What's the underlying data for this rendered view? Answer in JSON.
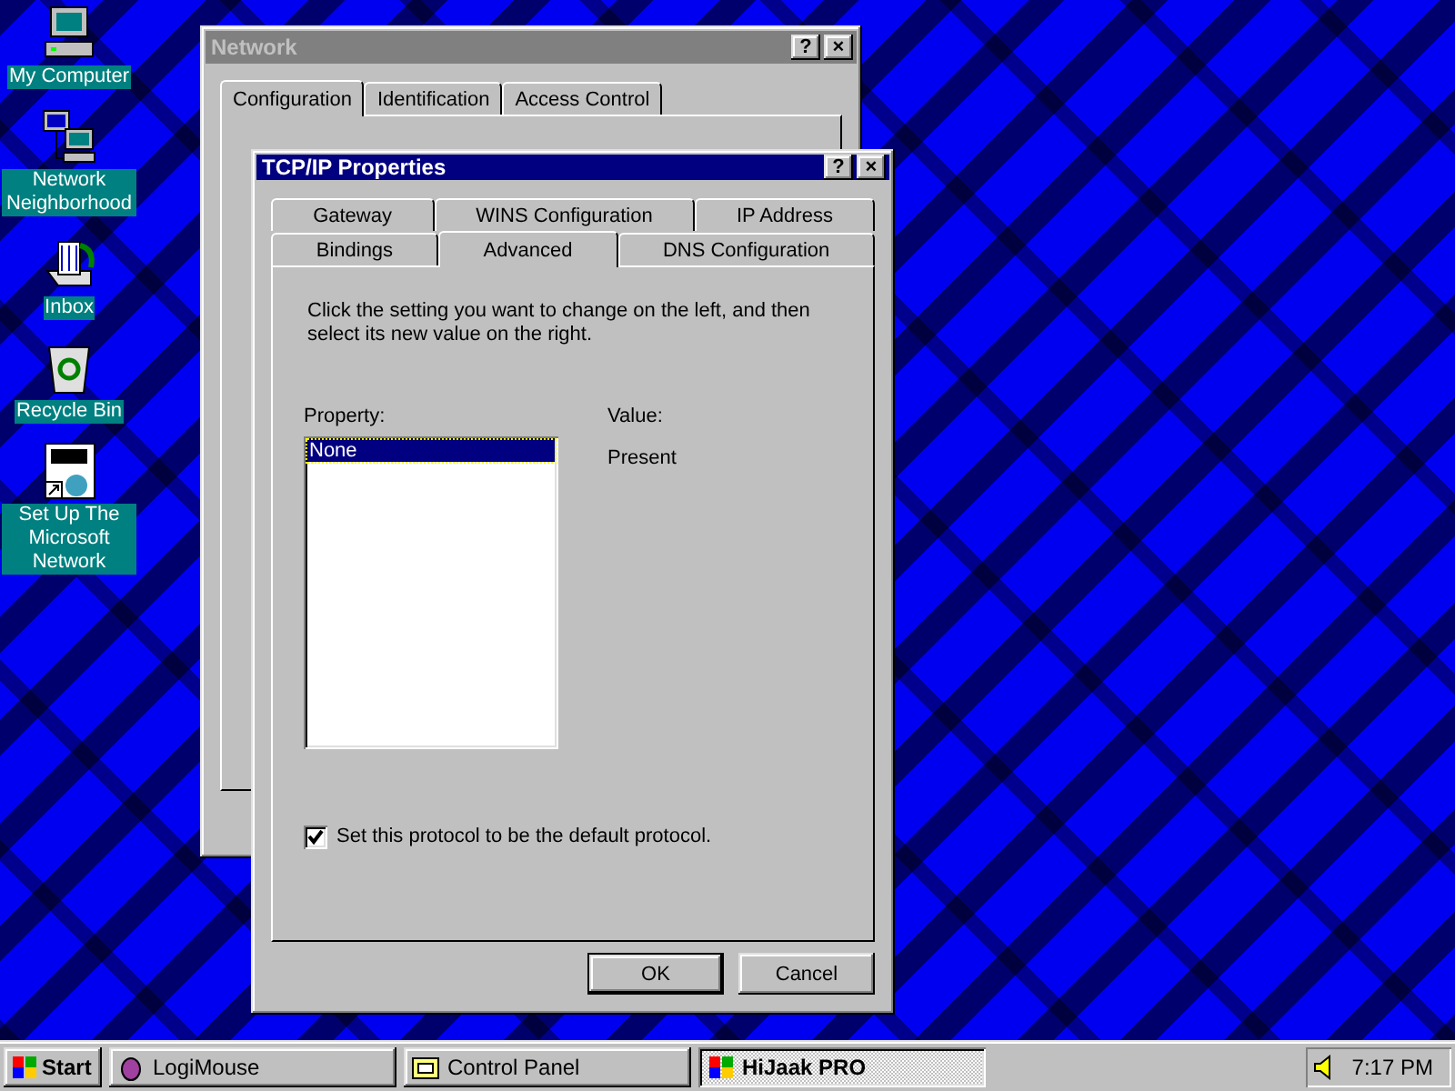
{
  "desktop_icons": [
    {
      "label": "My Computer",
      "kind": "computer"
    },
    {
      "label": "Network Neighborhood",
      "kind": "network"
    },
    {
      "label": "Inbox",
      "kind": "inbox"
    },
    {
      "label": "Recycle Bin",
      "kind": "recycle"
    },
    {
      "label": "Set Up The Microsoft Network",
      "kind": "msn"
    }
  ],
  "network_window": {
    "title": "Network",
    "active": false,
    "title_buttons": [
      "?",
      "×"
    ],
    "tabs": [
      {
        "label": "Configuration",
        "selected": true
      },
      {
        "label": "Identification",
        "selected": false
      },
      {
        "label": "Access Control",
        "selected": false
      }
    ]
  },
  "tcpip_window": {
    "title": "TCP/IP Properties",
    "active": true,
    "title_buttons": [
      "?",
      "×"
    ],
    "tab_rows": [
      [
        {
          "label": "Gateway",
          "selected": false
        },
        {
          "label": "WINS Configuration",
          "selected": false
        },
        {
          "label": "IP Address",
          "selected": false
        }
      ],
      [
        {
          "label": "Bindings",
          "selected": false
        },
        {
          "label": "Advanced",
          "selected": true
        },
        {
          "label": "DNS Configuration",
          "selected": false
        }
      ]
    ],
    "instructions": "Click the setting you want to change on the left, and then select its new value on the right.",
    "property_label": "Property:",
    "property_items": [
      {
        "text": "None",
        "selected": true
      }
    ],
    "value_label": "Value:",
    "value": "Present",
    "default_protocol": {
      "label": "Set this protocol to be the default protocol.",
      "checked": true
    },
    "buttons": [
      {
        "label": "OK",
        "default": true
      },
      {
        "label": "Cancel",
        "default": false
      }
    ]
  },
  "taskbar": {
    "start": "Start",
    "tasks": [
      {
        "label": "LogiMouse",
        "selected": false,
        "kind": "mouse"
      },
      {
        "label": "Control Panel",
        "selected": false,
        "kind": "folder"
      },
      {
        "label": "HiJaak PRO",
        "selected": true,
        "kind": "app"
      }
    ],
    "clock": "7:17 PM"
  }
}
